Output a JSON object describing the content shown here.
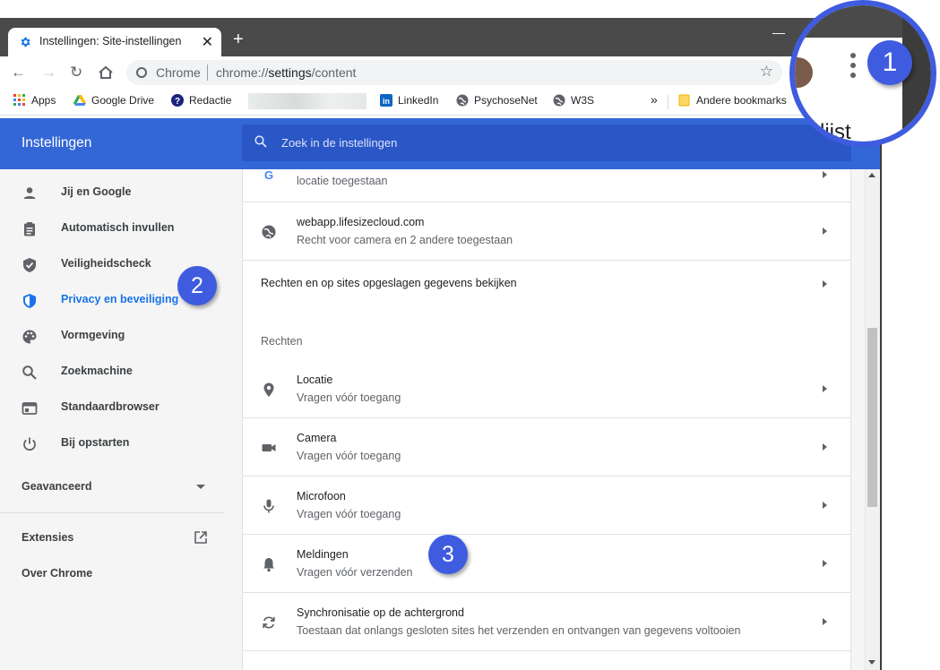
{
  "browser": {
    "tab_title": "Instellingen: Site-instellingen",
    "tab_close": "✕",
    "new_tab": "+",
    "omnibox_site": "Chrome",
    "omnibox_url_prefix": "chrome://",
    "omnibox_url_path": "settings",
    "omnibox_url_suffix": "/content"
  },
  "bookmarks": {
    "items": [
      {
        "label": "Apps",
        "icon": "apps-grid-icon"
      },
      {
        "label": "Google Drive",
        "icon": "google-drive-icon"
      },
      {
        "label": "Redactie",
        "icon": "help-icon"
      },
      {
        "label": "LinkedIn",
        "icon": "linkedin-icon"
      },
      {
        "label": "PsychoseNet",
        "icon": "globe-icon"
      },
      {
        "label": "W3S",
        "icon": "globe-icon"
      }
    ],
    "overflow": "»",
    "other": "Andere bookmarks"
  },
  "settings": {
    "title": "Instellingen",
    "search_placeholder": "Zoek in de instellingen"
  },
  "nav": {
    "items": [
      {
        "label": "Jij en Google",
        "icon": "person-icon"
      },
      {
        "label": "Automatisch invullen",
        "icon": "clipboard-icon"
      },
      {
        "label": "Veiligheidscheck",
        "icon": "shield-check-icon"
      },
      {
        "label": "Privacy en beveiliging",
        "icon": "shield-icon",
        "active": true
      },
      {
        "label": "Vormgeving",
        "icon": "palette-icon"
      },
      {
        "label": "Zoekmachine",
        "icon": "search-icon"
      },
      {
        "label": "Standaardbrowser",
        "icon": "browser-icon"
      },
      {
        "label": "Bij opstarten",
        "icon": "power-icon"
      }
    ],
    "advanced": "Geavanceerd",
    "extensions": "Extensies",
    "about": "Over Chrome"
  },
  "content": {
    "partial_row_sub": "locatie toegestaan",
    "webapp_title": "webapp.lifesizecloud.com",
    "webapp_sub": "Recht voor camera en 2 andere toegestaan",
    "rights_link": "Rechten en op sites opgeslagen gegevens bekijken",
    "section_title": "Rechten",
    "permissions": [
      {
        "title": "Locatie",
        "sub": "Vragen vóór toegang",
        "icon": "location-pin-icon"
      },
      {
        "title": "Camera",
        "sub": "Vragen vóór toegang",
        "icon": "camera-icon"
      },
      {
        "title": "Microfoon",
        "sub": "Vragen vóór toegang",
        "icon": "microphone-icon"
      },
      {
        "title": "Meldingen",
        "sub": "Vragen vóór verzenden",
        "icon": "bell-icon"
      },
      {
        "title": "Synchronisatie op de achtergrond",
        "sub": "Toestaan dat onlangs gesloten sites het verzenden en ontvangen van gegevens voltooien",
        "icon": "sync-icon"
      }
    ]
  },
  "annotations": {
    "badge_1": "1",
    "badge_2": "2",
    "badge_3": "3",
    "magnifier_text": "lijst",
    "color": "#3f5be0"
  }
}
